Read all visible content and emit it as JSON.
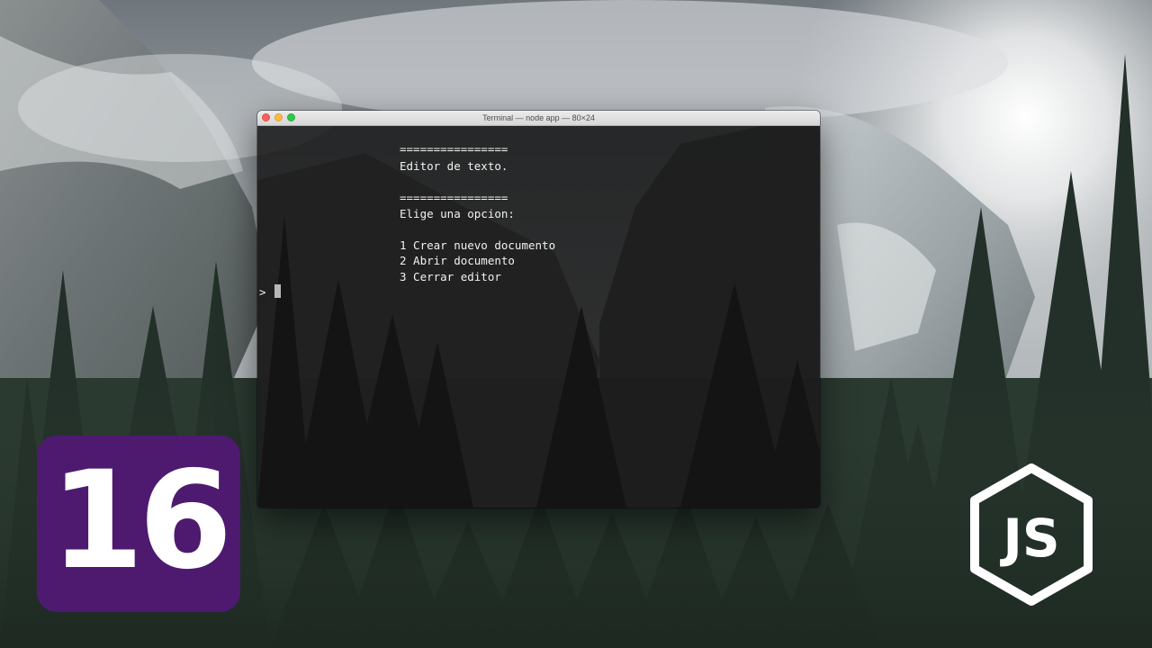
{
  "window": {
    "title": "Terminal — node app — 80×24"
  },
  "terminal": {
    "lines": [
      "================",
      "Editor de texto.",
      "================",
      "Elige una opcion:",
      "1 Crear nuevo documento",
      "2 Abrir documento",
      "3 Cerrar editor"
    ],
    "prompt": ">"
  },
  "overlay": {
    "episode_number": "16",
    "badge_color": "#4e1a6f",
    "logo": "nodejs-logo",
    "logo_text": "JS"
  },
  "colors": {
    "terminal_text": "#f2f2f2",
    "terminal_background": "#161616",
    "close": "#fc605c",
    "minimize": "#fdbc40",
    "zoom": "#34c84a"
  }
}
